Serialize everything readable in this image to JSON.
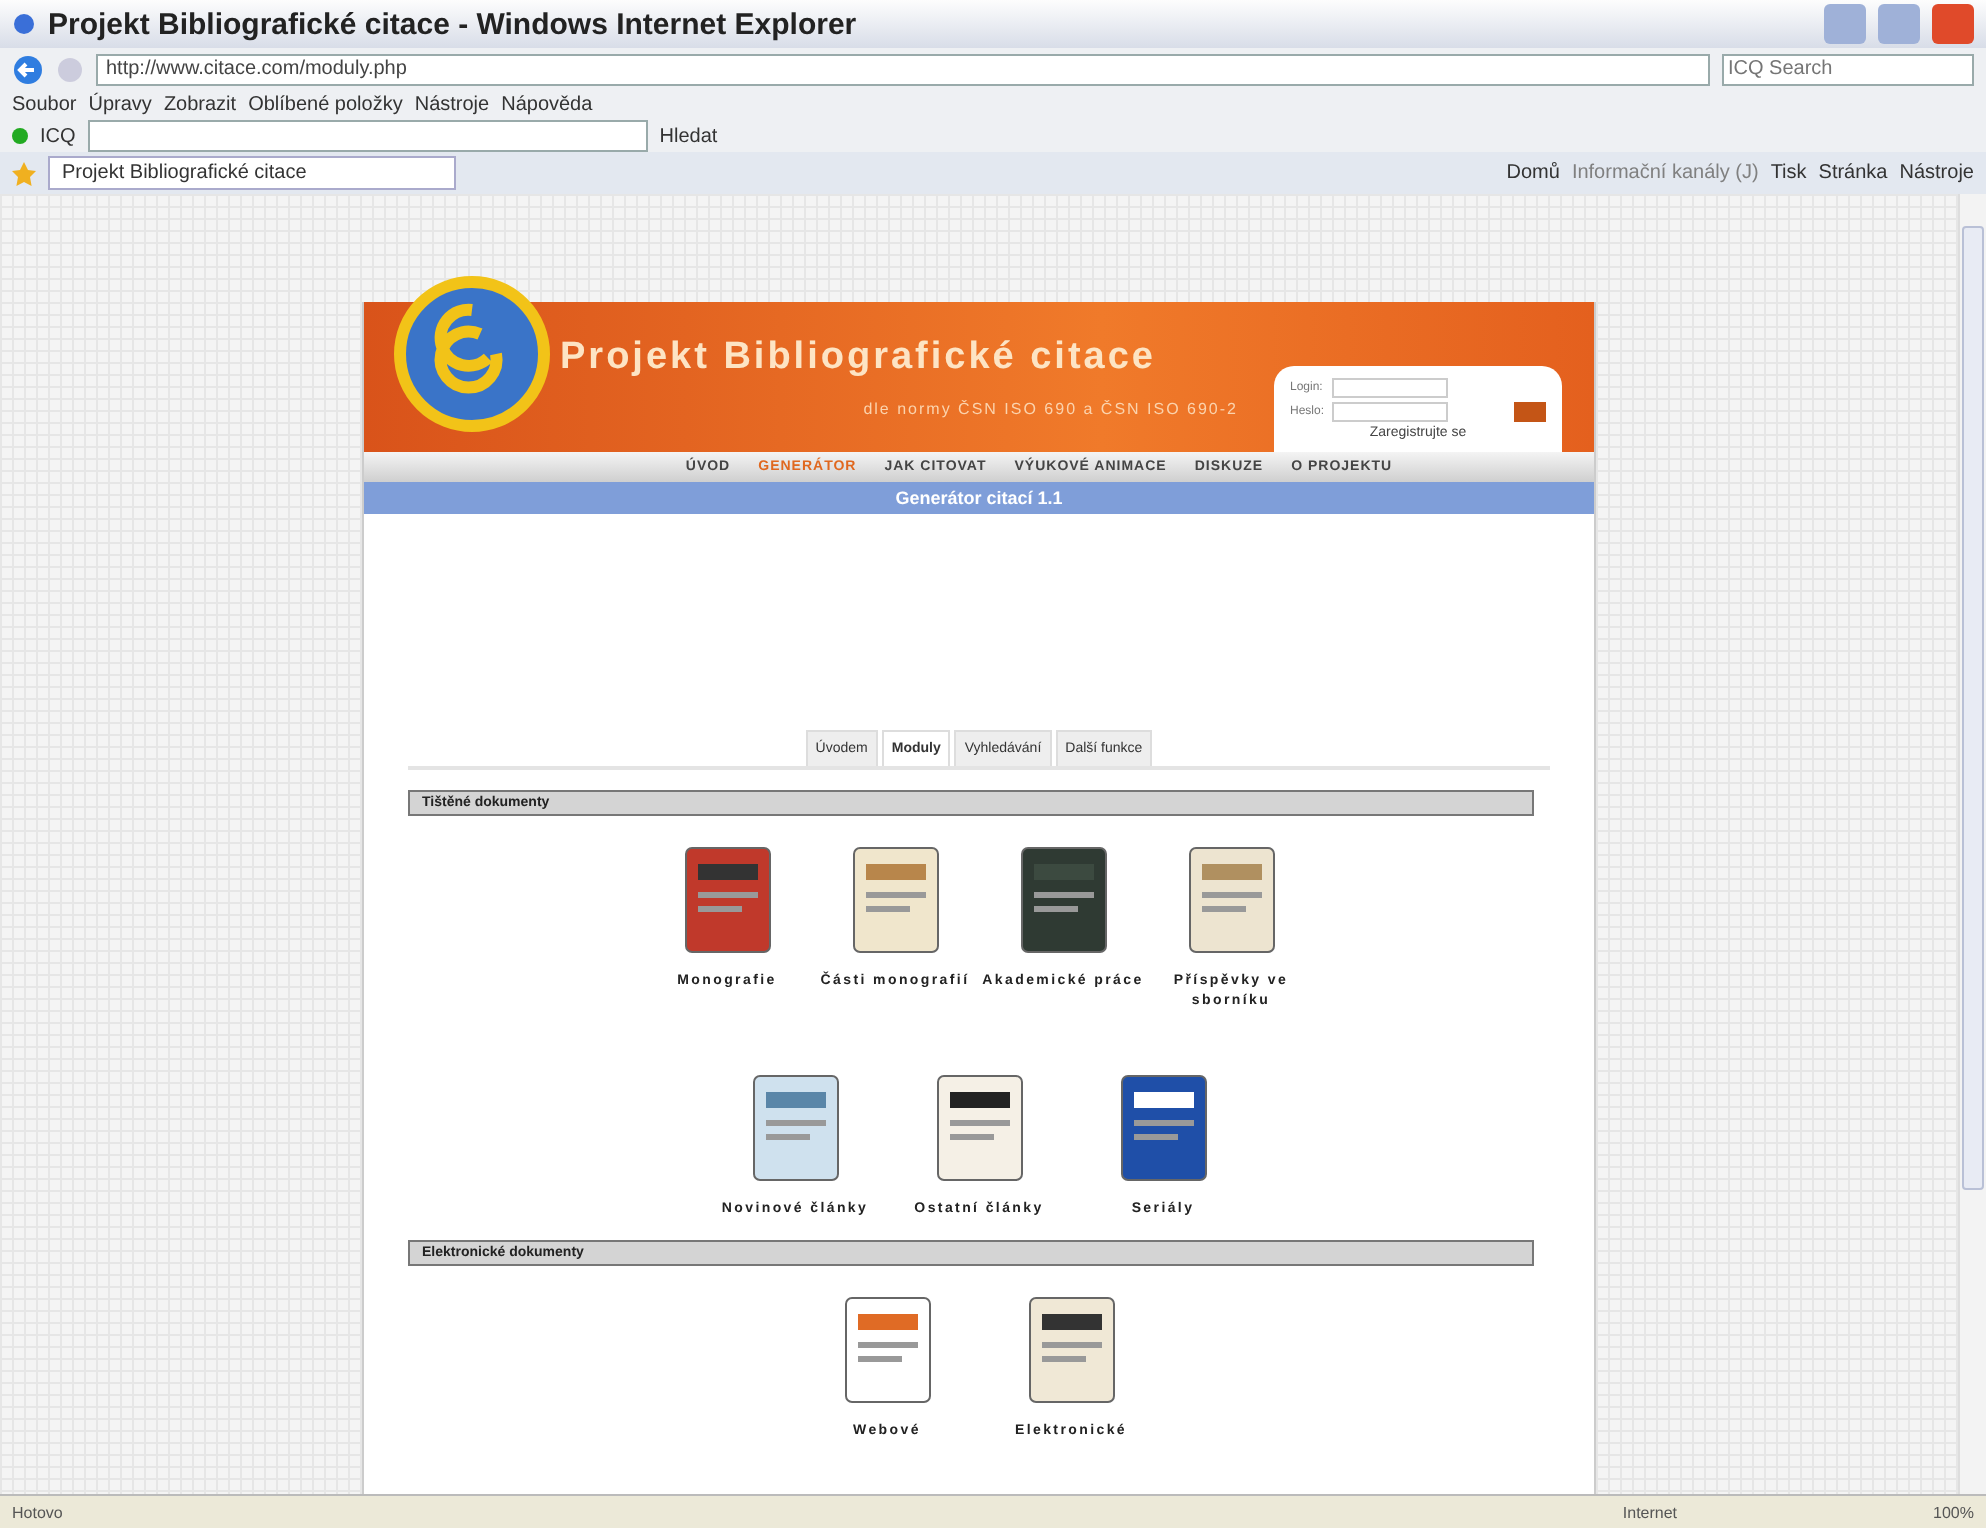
{
  "window": {
    "title": "Projekt Bibliografické citace - Windows Internet Explorer"
  },
  "address_bar": {
    "url": "http://www.citace.com/moduly.php",
    "search_placeholder": "ICQ Search"
  },
  "menu": [
    "Soubor",
    "Úpravy",
    "Zobrazit",
    "Oblíbené položky",
    "Nástroje",
    "Nápověda"
  ],
  "icq_toolbar": {
    "label": "ICQ",
    "search_button": "Hledat"
  },
  "browser_tab": {
    "label": "Projekt Bibliografické citace"
  },
  "command_bar": [
    {
      "label": "Domů",
      "disabled": false
    },
    {
      "label": "Informační kanály (J)",
      "disabled": true
    },
    {
      "label": "Tisk",
      "disabled": false
    },
    {
      "label": "Stránka",
      "disabled": false
    },
    {
      "label": "Nástroje",
      "disabled": false
    }
  ],
  "site": {
    "title": "Projekt Bibliografické citace",
    "subtitle": "dle normy ČSN ISO 690 a ČSN ISO 690-2",
    "login": {
      "login_label": "Login:",
      "password_label": "Heslo:",
      "register_link": "Zaregistrujte se"
    },
    "nav": [
      {
        "label": "ÚVOD",
        "selected": false
      },
      {
        "label": "GENERÁTOR",
        "selected": true
      },
      {
        "label": "JAK CITOVAT",
        "selected": false
      },
      {
        "label": "VÝUKOVÉ ANIMACE",
        "selected": false
      },
      {
        "label": "DISKUZE",
        "selected": false
      },
      {
        "label": "O PROJEKTU",
        "selected": false
      }
    ],
    "banner": "Generátor citací 1.1",
    "tabs": [
      {
        "label": "Úvodem",
        "selected": false
      },
      {
        "label": "Moduly",
        "selected": true
      },
      {
        "label": "Vyhledávání",
        "selected": false
      },
      {
        "label": "Další funkce",
        "selected": false
      }
    ],
    "sections": [
      {
        "title": "Tištěné dokumenty",
        "rows": [
          [
            "Monografie",
            "Části monografií",
            "Akademické práce",
            "Příspěvky ve sborníku"
          ],
          [
            "Novinové články",
            "Ostatní články",
            "Seriály"
          ]
        ]
      },
      {
        "title": "Elektronické dokumenty",
        "rows": [
          [
            "Webové",
            "Elektronické"
          ]
        ]
      }
    ]
  },
  "status_bar": {
    "text": "Hotovo",
    "zone": "Internet",
    "zoom": "100%"
  }
}
